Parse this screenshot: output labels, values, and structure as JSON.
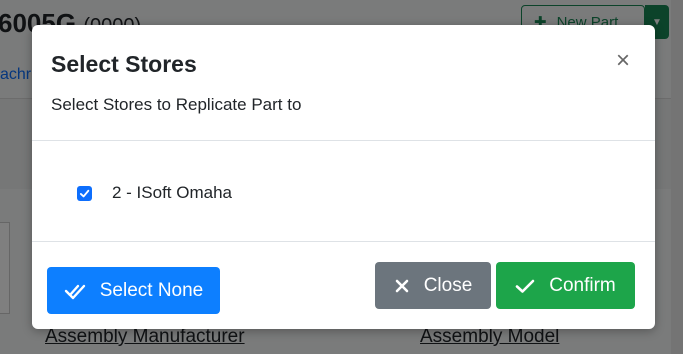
{
  "background": {
    "title": "6005G",
    "title_sub": "(0000)",
    "tab_label": "achr",
    "new_part_label": "New Part",
    "links": {
      "assembly_manufacturer": "Assembly Manufacturer",
      "assembly_model": "Assembly Model"
    }
  },
  "modal": {
    "title": "Select Stores",
    "subtitle": "Select Stores to Replicate Part to",
    "close_icon": "close-icon",
    "stores": [
      {
        "label": "2 - ISoft Omaha",
        "checked": true
      }
    ],
    "footer": {
      "select_none_label": "Select None",
      "close_label": "Close",
      "confirm_label": "Confirm"
    }
  },
  "colors": {
    "primary": "#0d7fff",
    "secondary": "#6c757d",
    "success": "#1da54a",
    "checkbox": "#0d6efd"
  }
}
